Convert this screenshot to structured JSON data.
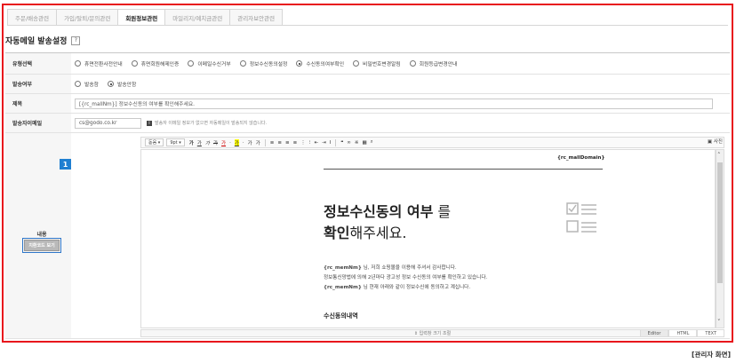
{
  "tabs": [
    "주문/배송관련",
    "가입/탈퇴/문의관련",
    "회원정보관련",
    "마일리지/예치금관련",
    "관리자보안관련"
  ],
  "active_tab_index": 2,
  "section": {
    "title": "자동메일 발송설정",
    "help": "?"
  },
  "form": {
    "type": {
      "label": "유형선택",
      "options": [
        "휴면전환사전안내",
        "휴면회원해제인증",
        "이메일수신거부",
        "정보수신동의설정",
        "수신동의여부확인",
        "비밀번호변경알림",
        "회원등급변경안내"
      ],
      "selected_index": 4
    },
    "send": {
      "label": "발송여부",
      "options": [
        "발송함",
        "발송안함"
      ],
      "selected_index": 1
    },
    "subject": {
      "label": "제목",
      "value": "[{rc_mallNm}] 정보수신동의 여부를 확인해주세요."
    },
    "sender": {
      "label": "발송자이메일",
      "value": "cs@godo.co.kr",
      "note_icon": "i",
      "note": "발송자 이메일 정보가 없으면 자동메일이 발송되지 않습니다."
    },
    "content": {
      "label": "내용",
      "source_button": "치환코드 보기",
      "badge": "1"
    }
  },
  "editor": {
    "font_select": "돋움",
    "size_select": "9pt",
    "toolbar_buttons": [
      "가",
      "가",
      "가",
      "가",
      "가",
      "·",
      "가",
      "·",
      "가",
      "가"
    ],
    "fullscreen": "사진",
    "doc": {
      "domain": "{rc_mallDomain}",
      "headline_bold1": "정보수신동의 여부",
      "headline_rest1": " 를",
      "headline_bold2": "확인",
      "headline_rest2": "해주세요.",
      "p1_code": "{rc_memNm}",
      "p1_text": " 님, 저희 쇼핑몰을 이용해 주셔서 감사합니다.",
      "p2_text": "정보통신망법에 의해 2년마다 광고성 정보 수신동의 여부를 확인하고 있습니다.",
      "p3_code": "{rc_memNm}",
      "p3_text": " 님 현재 아래와 같이 정보수신에 동의하고 계십니다.",
      "subhead": "수신동의내역"
    },
    "resize_label": "⇕ 입력창 크기 조절",
    "modes": [
      "Editor",
      "HTML",
      "TEXT"
    ],
    "active_mode_index": 0
  },
  "caption": "[관리자 화면]",
  "colors": {
    "frame": "#e8151c",
    "badge": "#1f7fd1"
  }
}
